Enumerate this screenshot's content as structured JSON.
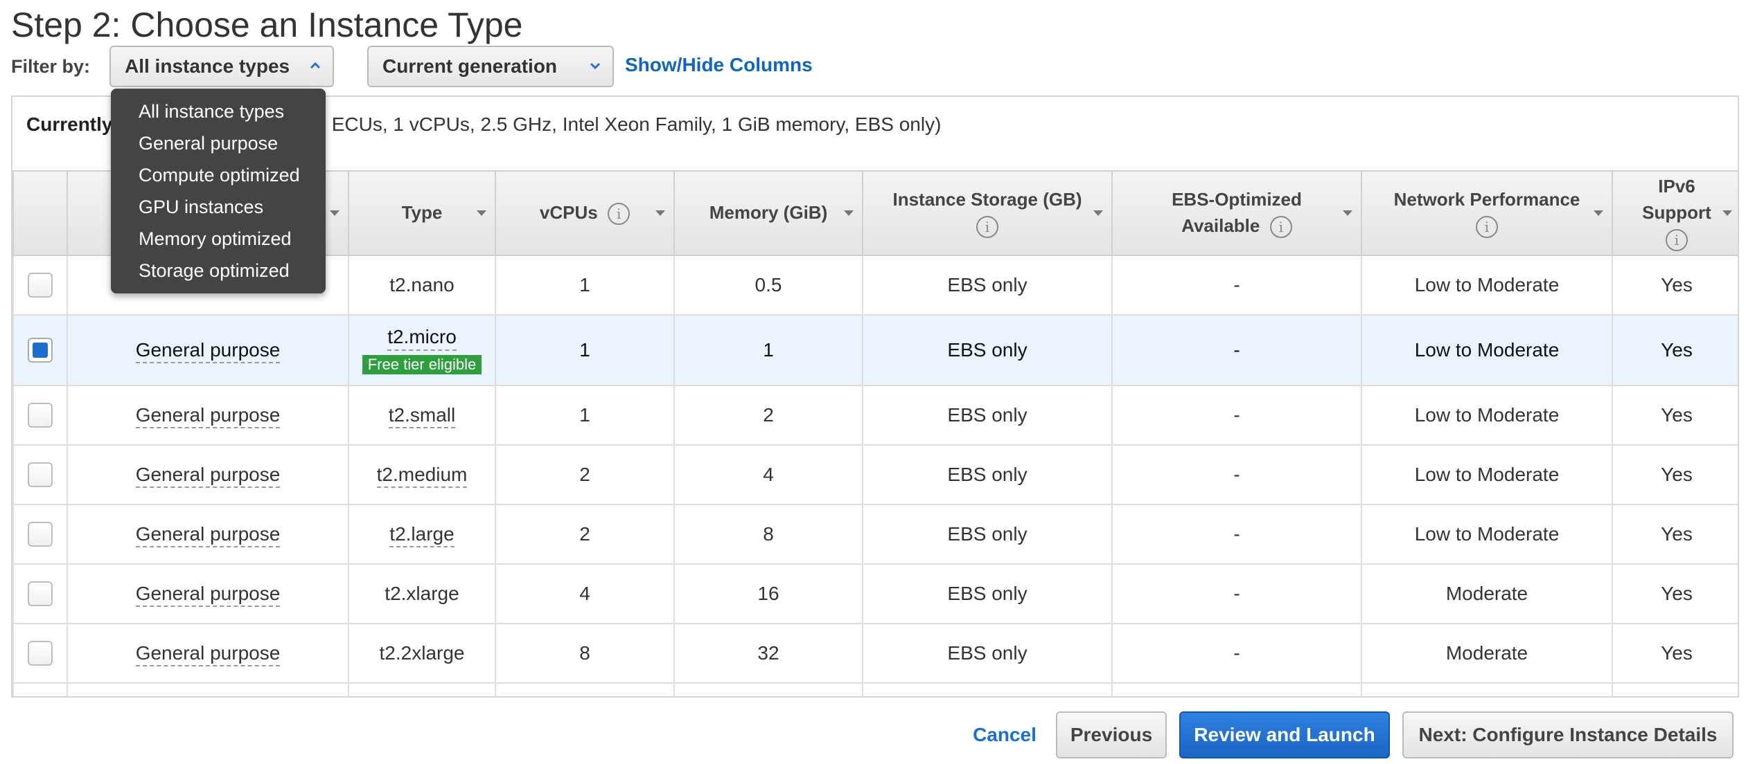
{
  "page": {
    "title": "Step 2: Choose an Instance Type"
  },
  "filter": {
    "label": "Filter by:",
    "instance_type_select": "All instance types",
    "generation_select": "Current generation",
    "show_hide_link": "Show/Hide Columns",
    "dropdown_options": [
      "All instance types",
      "General purpose",
      "Compute optimized",
      "GPU instances",
      "Memory optimized",
      "Storage optimized"
    ]
  },
  "currently": {
    "label": "Currently",
    "text": "able ECUs, 1 vCPUs, 2.5 GHz, Intel Xeon Family, 1 GiB memory, EBS only)"
  },
  "table": {
    "headers": {
      "type": "Type",
      "vcpus": "vCPUs",
      "memory": "Memory (GiB)",
      "storage": "Instance Storage (GB)",
      "ebs_line1": "EBS-Optimized",
      "ebs_line2": "Available",
      "network": "Network Performance",
      "ipv6_line1": "IPv6",
      "ipv6_line2": "Support"
    },
    "rows": [
      {
        "family": "",
        "type": "t2.nano",
        "vcpus": "1",
        "memory": "0.5",
        "storage": "EBS only",
        "ebs": "-",
        "network": "Low to Moderate",
        "ipv6": "Yes"
      },
      {
        "family": "General purpose",
        "type": "t2.micro",
        "badge": "Free tier eligible",
        "vcpus": "1",
        "memory": "1",
        "storage": "EBS only",
        "ebs": "-",
        "network": "Low to Moderate",
        "ipv6": "Yes"
      },
      {
        "family": "General purpose",
        "type": "t2.small",
        "vcpus": "1",
        "memory": "2",
        "storage": "EBS only",
        "ebs": "-",
        "network": "Low to Moderate",
        "ipv6": "Yes"
      },
      {
        "family": "General purpose",
        "type": "t2.medium",
        "vcpus": "2",
        "memory": "4",
        "storage": "EBS only",
        "ebs": "-",
        "network": "Low to Moderate",
        "ipv6": "Yes"
      },
      {
        "family": "General purpose",
        "type": "t2.large",
        "vcpus": "2",
        "memory": "8",
        "storage": "EBS only",
        "ebs": "-",
        "network": "Low to Moderate",
        "ipv6": "Yes"
      },
      {
        "family": "General purpose",
        "type": "t2.xlarge",
        "vcpus": "4",
        "memory": "16",
        "storage": "EBS only",
        "ebs": "-",
        "network": "Moderate",
        "ipv6": "Yes"
      },
      {
        "family": "General purpose",
        "type": "t2.2xlarge",
        "vcpus": "8",
        "memory": "32",
        "storage": "EBS only",
        "ebs": "-",
        "network": "Moderate",
        "ipv6": "Yes"
      }
    ]
  },
  "footer": {
    "cancel": "Cancel",
    "previous": "Previous",
    "review": "Review and Launch",
    "next": "Next: Configure Instance Details"
  },
  "colors": {
    "accent_blue": "#1a6fd0",
    "free_tier_green": "#2e9e3e",
    "selected_row": "#ebf3fd",
    "dropdown_bg": "#444444"
  }
}
